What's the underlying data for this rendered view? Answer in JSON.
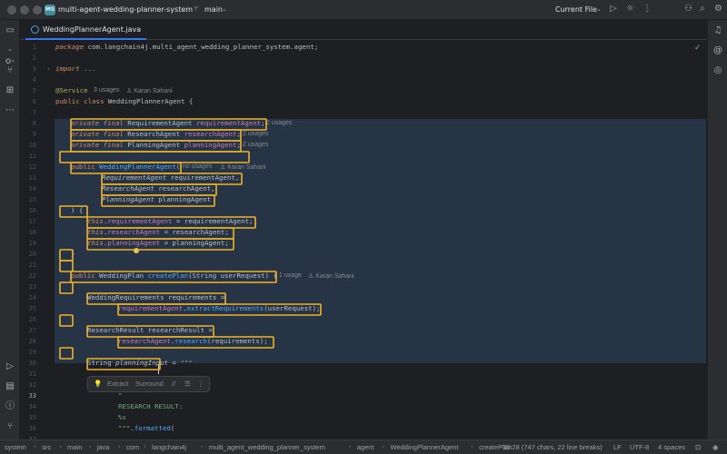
{
  "titlebar": {
    "project_badge": "MS",
    "project_name": "multi-agent-wedding-planner-system",
    "branch": "main",
    "run_config": "Current File"
  },
  "tab": {
    "label": "WeddingPlannerAgent.java"
  },
  "code": {
    "l1_pkg": "package",
    "l1_rest": " com.langchain4j.multi_agent_wedding_planner_system.agent;",
    "l3_import": "import",
    "l3_rest": " ...",
    "l5_ann": "@Service",
    "l5_usages": "3 usages",
    "l5_author": "Karan Sahani",
    "l6": "public class WeddingPlannerAgent {",
    "l11": "private final RequirementAgent requirementAgent;",
    "l11_usages": "2 usages",
    "l12": "private final ResearchAgent researchAgent;",
    "l12_usages": "2 usages",
    "l13": "private final PlanningAgent planningAgent;",
    "l13_usages": "2 usages",
    "l15": "public WeddingPlannerAgent(",
    "l15_usages": "no usages",
    "l15_author": "Karan Sahani",
    "l16": "RequirementAgent requirementAgent,",
    "l17": "ResearchAgent researchAgent,",
    "l18": "PlanningAgent planningAgent",
    "l19": ") {",
    "l20": "this.requirementAgent = requirementAgent;",
    "l21": "this.researchAgent = researchAgent;",
    "l22": "this.planningAgent = planningAgent;",
    "l23": "}",
    "l25": "public WeddingPlan createPlan(String userRequest) {",
    "l25_usages": "1 usage",
    "l25_author": "Karan Sahani",
    "l27": "WeddingRequirements requirements =",
    "l28": "requirementAgent.extractRequirements(userRequest);",
    "l30": "ResearchResult researchResult =",
    "l31": "researchAgent.research(requirements);",
    "l33": "String planningInput = \"\"\"",
    "l36": "\"",
    "l37": "RESEARCH RESULT:",
    "l38": "%s",
    "l39": "\"\"\".formatted("
  },
  "popup": {
    "extract": "Extract",
    "surround": "Surround"
  },
  "statusbar": {
    "path": [
      "system",
      "src",
      "main",
      "java",
      "com",
      "langchain4j",
      "multi_agent_wedding_planner_system",
      "agent",
      "WeddingPlannerAgent",
      "createPlan"
    ],
    "position": "33:28 (747 chars, 22 line breaks)",
    "line_sep": "LF",
    "encoding": "UTF-8",
    "indent": "4 spaces"
  },
  "colors": {
    "accent": "#3574f0",
    "highlight": "#f0b429",
    "selection": "#273445"
  }
}
